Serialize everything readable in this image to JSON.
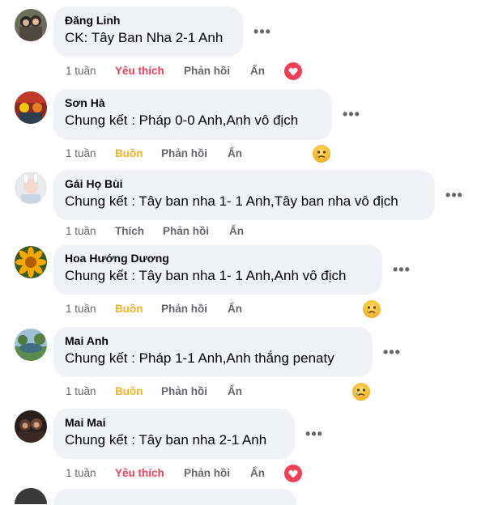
{
  "comments": [
    {
      "name": "Đăng Linh",
      "text": "CK: Tây Ban Nha 2-1 Anh",
      "time": "1 tuần",
      "like_label": "Yêu thích",
      "reply_label": "Phản hồi",
      "hide_label": "Ẩn",
      "reaction": "heart-icon",
      "like_state": "love"
    },
    {
      "name": "Sơn Hà",
      "text": "Chung kết : Pháp 0-0 Anh,Anh vô địch",
      "time": "1 tuần",
      "like_label": "Buồn",
      "reply_label": "Phản hồi",
      "hide_label": "Ẩn",
      "reaction": "sad-face-icon",
      "like_state": "sad"
    },
    {
      "name": "Gái Họ Bùi",
      "text": "Chung kết : Tây ban nha 1- 1 Anh,Tây ban nha vô địch",
      "time": "1 tuần",
      "like_label": "Thích",
      "reply_label": "Phản hồi",
      "hide_label": "Ẩn",
      "reaction": "",
      "like_state": "none"
    },
    {
      "name": "Hoa Hướng Dương",
      "text": "Chung kết : Tây ban nha 1- 1 Anh,Anh vô địch",
      "time": "1 tuần",
      "like_label": "Buồn",
      "reply_label": "Phản hồi",
      "hide_label": "Ẩn",
      "reaction": "sad-face-icon",
      "like_state": "sad"
    },
    {
      "name": "Mai Anh",
      "text": "Chung kết : Pháp 1-1 Anh,Anh thắng penaty",
      "time": "1 tuần",
      "like_label": "Buồn",
      "reply_label": "Phản hồi",
      "hide_label": "Ẩn",
      "reaction": "sad-face-icon",
      "like_state": "sad"
    },
    {
      "name": "Mai Mai",
      "text": "Chung kết : Tây ban nha 2-1 Anh",
      "time": "1 tuần",
      "like_label": "Yêu thích",
      "reply_label": "Phản hồi",
      "hide_label": "Ẩn",
      "reaction": "heart-icon",
      "like_state": "love"
    }
  ],
  "more_glyph": "•••",
  "colors": {
    "love": "#f33e58",
    "sad": "#f7b125",
    "muted": "#65676b",
    "bubble": "#f0f2f5"
  }
}
